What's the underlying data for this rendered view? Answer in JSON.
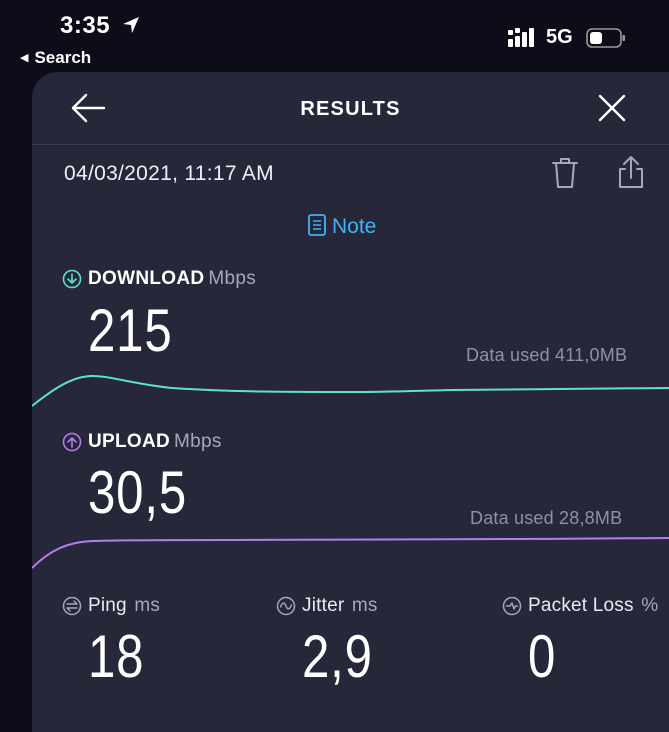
{
  "status_bar": {
    "time": "3:35",
    "back_app": "Search",
    "network": "5G"
  },
  "header": {
    "title": "RESULTS"
  },
  "result": {
    "date": "04/03/2021, 11:17 AM",
    "note_label": "Note"
  },
  "download": {
    "label": "DOWNLOAD",
    "unit": "Mbps",
    "value": "215",
    "data_used": "Data used 411,0MB",
    "color": "#5ee2d0"
  },
  "upload": {
    "label": "UPLOAD",
    "unit": "Mbps",
    "value": "30,5",
    "data_used": "Data used 28,8MB",
    "color": "#b57cf0"
  },
  "ping": {
    "label": "Ping",
    "unit": "ms",
    "value": "18"
  },
  "jitter": {
    "label": "Jitter",
    "unit": "ms",
    "value": "2,9"
  },
  "packet_loss": {
    "label": "Packet Loss",
    "unit": "%",
    "value": "0"
  },
  "colors": {
    "accent_blue": "#41b3f5",
    "card_bg": "#262839",
    "screen_bg": "#0c0d18"
  }
}
